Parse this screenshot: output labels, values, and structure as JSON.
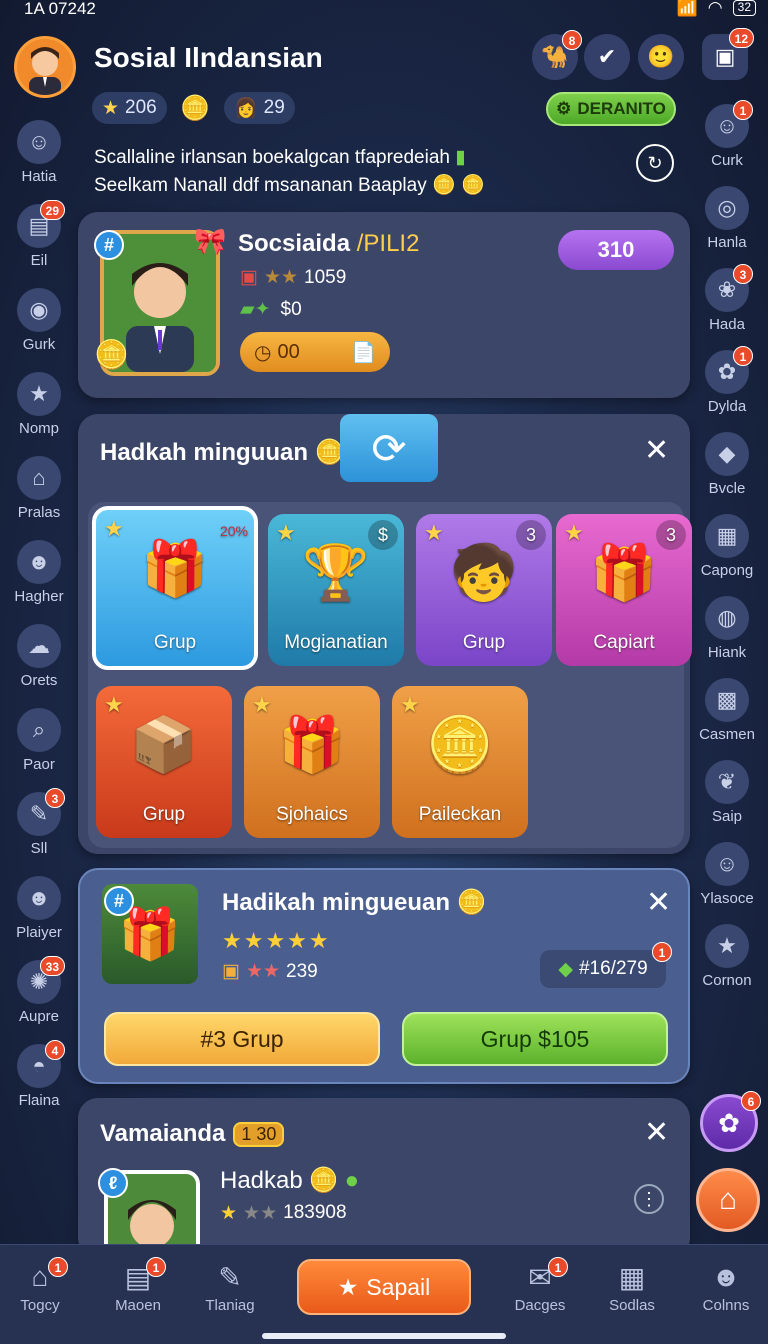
{
  "status": {
    "time": "1A 07242",
    "battery": "32"
  },
  "header": {
    "title": "Sosial Ilndansian",
    "stars": "206",
    "level": "29",
    "action_button": "DERANITO",
    "intro_line1": "Scallaline irlansan boekalgcan tfapredeiah",
    "intro_line2": "Seelkam Nanall ddf msananan Baaplay",
    "icon_badges": {
      "shop": "8",
      "mail": "12"
    }
  },
  "left_rail": [
    {
      "label": "Hatia",
      "icon": "face-icon",
      "badge": ""
    },
    {
      "label": "Eil",
      "icon": "chat-icon",
      "badge": "29"
    },
    {
      "label": "Gurk",
      "icon": "food-icon",
      "badge": ""
    },
    {
      "label": "Nomp",
      "icon": "star-icon",
      "badge": ""
    },
    {
      "label": "Pralas",
      "icon": "home-icon",
      "badge": ""
    },
    {
      "label": "Hagher",
      "icon": "person-icon",
      "badge": ""
    },
    {
      "label": "Orets",
      "icon": "cloud-icon",
      "badge": ""
    },
    {
      "label": "Paor",
      "icon": "search-icon",
      "badge": ""
    },
    {
      "label": "Sll",
      "icon": "note-icon",
      "badge": "3"
    },
    {
      "label": "Plaiyer",
      "icon": "person-icon",
      "badge": ""
    },
    {
      "label": "Aupre",
      "icon": "blob-icon",
      "badge": "33"
    },
    {
      "label": "Flaina",
      "icon": "hat-icon",
      "badge": "4"
    }
  ],
  "right_rail": [
    {
      "label": "Curk",
      "icon": "face-icon",
      "badge": "1"
    },
    {
      "label": "Hanla",
      "icon": "target-icon",
      "badge": ""
    },
    {
      "label": "Hada",
      "icon": "brain-icon",
      "badge": "3"
    },
    {
      "label": "Dylda",
      "icon": "flower-icon",
      "badge": "1"
    },
    {
      "label": "Bvcle",
      "icon": "kite-icon",
      "badge": ""
    },
    {
      "label": "Capong",
      "icon": "box-icon",
      "badge": ""
    },
    {
      "label": "Hiank",
      "icon": "lantern-icon",
      "badge": ""
    },
    {
      "label": "Casmen",
      "icon": "crate-icon",
      "badge": ""
    },
    {
      "label": "Saip",
      "icon": "leaf-icon",
      "badge": ""
    },
    {
      "label": "Ylasoce",
      "icon": "face-icon",
      "badge": ""
    },
    {
      "label": "Cornon",
      "icon": "star-icon",
      "badge": ""
    }
  ],
  "profile": {
    "name": "Socsiaida",
    "tag": "/PILI2",
    "rating": "1059",
    "cash": "$0",
    "timer": "00",
    "points": "310",
    "rank_badge": "#"
  },
  "gifts_panel": {
    "title": "Hadkah minguuan",
    "tiles": [
      {
        "label": "Grup",
        "corner": "20%",
        "theme": "blue"
      },
      {
        "label": "Mogianatian",
        "corner": "$",
        "theme": "teal"
      },
      {
        "label": "Grup",
        "corner": "3",
        "theme": "purple"
      },
      {
        "label": "Capiart",
        "corner": "3",
        "theme": "pink"
      },
      {
        "label": "Grup",
        "corner": "",
        "theme": "red"
      },
      {
        "label": "Sjohaics",
        "corner": "",
        "theme": "orange"
      },
      {
        "label": "Paileckan",
        "corner": "",
        "theme": "orange"
      }
    ]
  },
  "offer": {
    "title": "Hadikah mingueuan",
    "rating": "239",
    "price_tag": "#16/279",
    "price_badge": "1",
    "btn_left": "#3 Grup",
    "btn_right": "Grup $105"
  },
  "bottom_card": {
    "title": "Vamaianda",
    "count": "1 30",
    "name": "Hadkab",
    "rating": "183908"
  },
  "nav": [
    {
      "label": "Togcy",
      "badge": "1"
    },
    {
      "label": "Maoen",
      "badge": "1"
    },
    {
      "label": "Tlaniag",
      "badge": ""
    },
    {
      "label": "Dacges",
      "badge": "1"
    },
    {
      "label": "Sodlas",
      "badge": ""
    },
    {
      "label": "Colnns",
      "badge": ""
    }
  ],
  "nav_cta": "Sapail",
  "fab_badge": "6",
  "colors": {
    "accent": "#f08a2a",
    "panel": "#3c4669",
    "green": "#5cb22c",
    "purple": "#8a4ad0"
  }
}
